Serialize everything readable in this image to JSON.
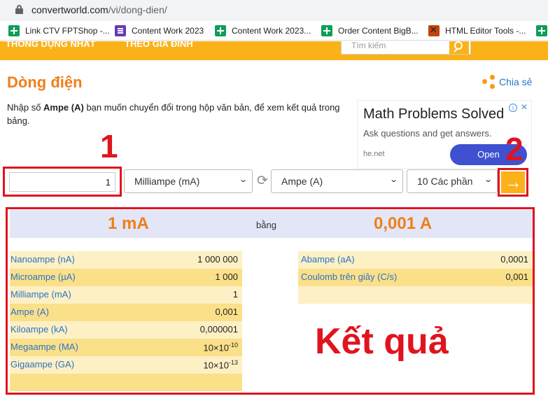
{
  "browser": {
    "url_host": "convertworld.com",
    "url_path": "/vi/dong-dien/",
    "bookmarks": [
      {
        "label": "Link CTV FPTShop -...",
        "icon": "sheets-icon"
      },
      {
        "label": "Content Work 2023",
        "icon": "forms-icon"
      },
      {
        "label": "Content Work 2023...",
        "icon": "sheets-icon"
      },
      {
        "label": "Order Content BigB...",
        "icon": "sheets-icon"
      },
      {
        "label": "HTML Editor Tools -...",
        "icon": "tools-icon"
      }
    ]
  },
  "nav": {
    "item1": "THÔNG DỤNG NHẤT",
    "item2": "THEO GIA ĐÌNH",
    "search_placeholder": "Tìm kiếm"
  },
  "page": {
    "title": "Dòng điện",
    "share_label": "Chia sẻ",
    "intro_pre": "Nhập số ",
    "intro_bold": "Ampe (A)",
    "intro_post": " bạn muốn chuyển đổi trong hộp văn bản, để xem kết quả trong bảng."
  },
  "ad": {
    "title": "Math Problems Solved",
    "subtitle": "Ask questions and get answers.",
    "domain": "he.net",
    "button": "Open"
  },
  "annotations": {
    "one": "1",
    "two": "2",
    "result": "Kết quả"
  },
  "converter": {
    "value": "1",
    "from_unit": "Milliampe (mA)",
    "to_unit": "Ampe (A)",
    "precision": "10 Các phần"
  },
  "result": {
    "from": "1 mA",
    "equals": "bằng",
    "to": "0,001 A"
  },
  "table_left": [
    {
      "unit": "Nanoampe (nA)",
      "value": "1 000 000"
    },
    {
      "unit": "Microampe (µA)",
      "value": "1 000"
    },
    {
      "unit": "Milliampe (mA)",
      "value": "1"
    },
    {
      "unit": "Ampe (A)",
      "value": "0,001"
    },
    {
      "unit": "Kiloampe (kA)",
      "value": "0,000001"
    },
    {
      "unit": "Megaampe (MA)",
      "mantissa": "10×10",
      "exp": "-10"
    },
    {
      "unit": "Gigaampe (GA)",
      "mantissa": "10×10",
      "exp": "-13"
    }
  ],
  "table_right": [
    {
      "unit": "Abampe (aA)",
      "value": "0,0001"
    },
    {
      "unit": "Coulomb trên giây (C/s)",
      "value": "0,001"
    }
  ],
  "colors": {
    "accent": "#ef7f1a",
    "nav": "#fbb218",
    "annotation": "#e0141e",
    "link": "#2a73c9"
  }
}
